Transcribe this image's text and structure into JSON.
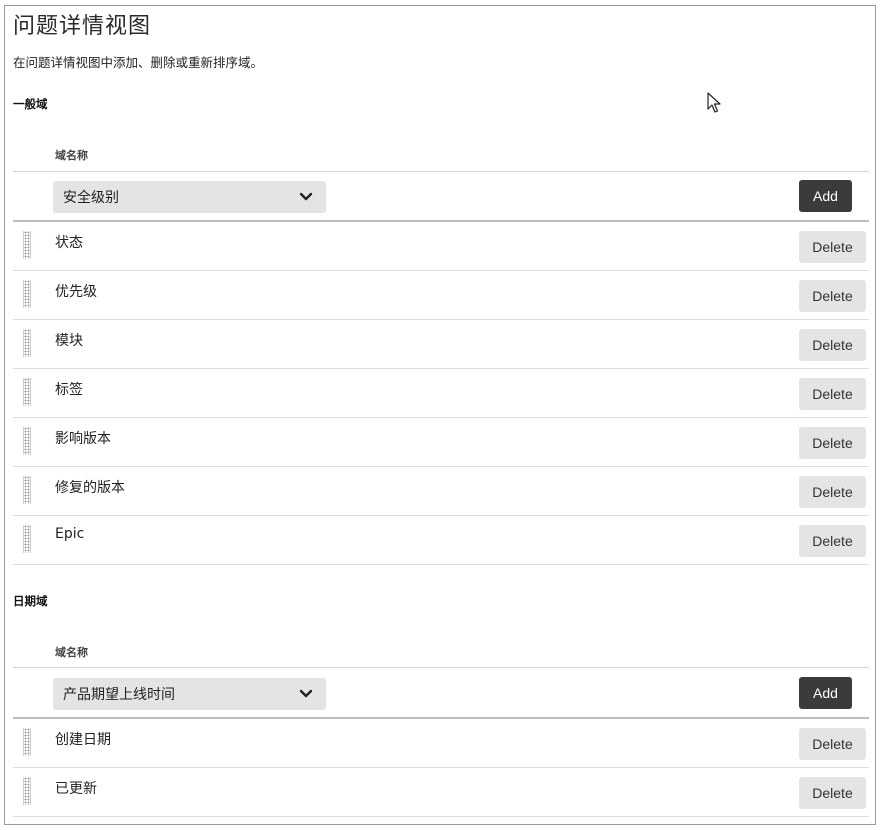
{
  "page": {
    "title": "问题详情视图",
    "description": "在问题详情视图中添加、删除或重新排序域。"
  },
  "general_section": {
    "title": "一般域",
    "column_header": "域名称",
    "select_value": "安全级别",
    "add_label": "Add",
    "fields": [
      {
        "label": "状态",
        "delete_label": "Delete"
      },
      {
        "label": "优先级",
        "delete_label": "Delete"
      },
      {
        "label": "模块",
        "delete_label": "Delete"
      },
      {
        "label": "标签",
        "delete_label": "Delete"
      },
      {
        "label": "影响版本",
        "delete_label": "Delete"
      },
      {
        "label": "修复的版本",
        "delete_label": "Delete"
      },
      {
        "label": "Epic",
        "delete_label": "Delete"
      }
    ]
  },
  "date_section": {
    "title": "日期域",
    "column_header": "域名称",
    "select_value": "产品期望上线时间",
    "add_label": "Add",
    "fields": [
      {
        "label": "创建日期",
        "delete_label": "Delete"
      },
      {
        "label": "已更新",
        "delete_label": "Delete"
      }
    ]
  },
  "icons": {
    "chevron": "chevron-down-icon",
    "handle": "drag-handle-icon",
    "cursor": "mouse-pointer-icon"
  },
  "colors": {
    "add_button_bg": "#3b3b3b",
    "control_bg": "#e4e4e4"
  }
}
